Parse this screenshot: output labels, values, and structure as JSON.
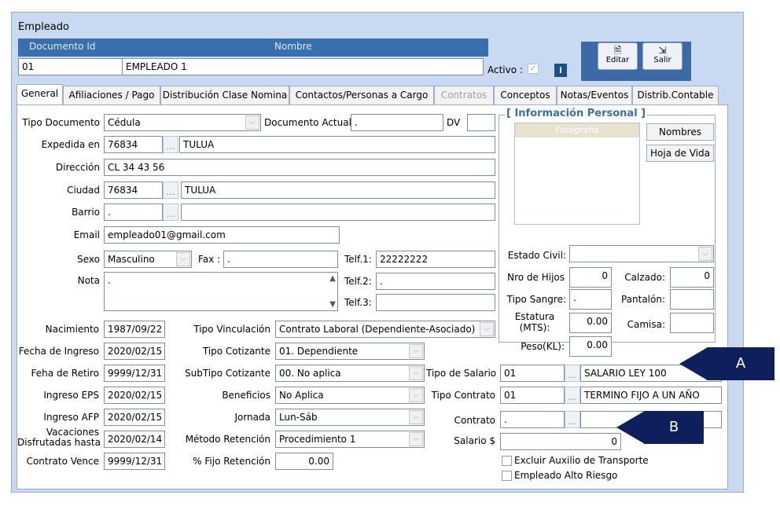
{
  "window": {
    "title": "Empleado"
  },
  "header": {
    "doc_id_label": "Documento Id",
    "nombre_label": "Nombre",
    "doc_id_value": "01",
    "nombre_value": "EMPLEADO 1",
    "activo_label": "Activo :",
    "info_icon": "i",
    "editar_label": "Editar",
    "salir_label": "Salir"
  },
  "tabs": [
    {
      "label": "General"
    },
    {
      "label": "Afiliaciones / Pago"
    },
    {
      "label": "Distribución Clase Nomina"
    },
    {
      "label": "Contactos/Personas a Cargo"
    },
    {
      "label": "Contratos"
    },
    {
      "label": "Conceptos"
    },
    {
      "label": "Notas/Eventos"
    },
    {
      "label": "Distrib.Contable"
    }
  ],
  "form": {
    "tipo_documento": {
      "label": "Tipo Documento",
      "value": "Cédula"
    },
    "documento_actual": {
      "label": "Documento Actual",
      "value": "."
    },
    "dv": {
      "label": "DV",
      "value": ""
    },
    "expedida_en": {
      "label": "Expedida en",
      "code": "76834",
      "name": "TULUA"
    },
    "direccion": {
      "label": "Dirección",
      "value": "CL 34 43 56"
    },
    "ciudad": {
      "label": "Ciudad",
      "code": "76834",
      "name": "TULUA"
    },
    "barrio": {
      "label": "Barrio",
      "code": ".",
      "name": ""
    },
    "email": {
      "label": "Email",
      "value": "empleado01@gmail.com"
    },
    "sexo": {
      "label": "Sexo",
      "value": "Masculino"
    },
    "fax": {
      "label": "Fax :",
      "value": "."
    },
    "telf1": {
      "label": "Telf.1:",
      "value": "22222222"
    },
    "telf2": {
      "label": "Telf.2:",
      "value": "."
    },
    "telf3": {
      "label": "Telf.3:",
      "value": ""
    },
    "nota": {
      "label": "Nota",
      "value": "."
    },
    "nacimiento": {
      "label": "Nacimiento",
      "value": "1987/09/22"
    },
    "fecha_ingreso": {
      "label": "Fecha de Ingreso",
      "value": "2020/02/15"
    },
    "fecha_retiro": {
      "label": "Feha de Retiro",
      "value": "9999/12/31"
    },
    "ingreso_eps": {
      "label": "Ingreso EPS",
      "value": "2020/02/15"
    },
    "ingreso_afp": {
      "label": "Ingreso AFP",
      "value": "2020/02/15"
    },
    "vacaciones": {
      "label1": "Vacaciones",
      "label2": "Disfrutadas hasta",
      "value": "2020/02/14"
    },
    "contrato_vence": {
      "label": "Contrato Vence",
      "value": "9999/12/31"
    },
    "tipo_vinculacion": {
      "label": "Tipo Vinculación",
      "value": "Contrato Laboral (Dependiente-Asociado)"
    },
    "tipo_cotizante": {
      "label": "Tipo Cotizante",
      "value": "01. Dependiente"
    },
    "subtipo_cotizante": {
      "label": "SubTipo Cotizante",
      "value": "00. No aplica"
    },
    "beneficios": {
      "label": "Beneficios",
      "value": "No Aplica"
    },
    "jornada": {
      "label": "Jornada",
      "value": "Lun-Sáb"
    },
    "metodo_retencion": {
      "label": "Método Retención",
      "value": "Procedimiento 1"
    },
    "fijo_retencion": {
      "label": "% Fijo Retención",
      "value": "0.00"
    },
    "tipo_salario": {
      "label": "Tipo de Salario",
      "code": "01",
      "name": "SALARIO LEY 100"
    },
    "tipo_contrato": {
      "label": "Tipo Contrato",
      "code": "01",
      "name": "TERMINO FIJO A UN AÑO"
    },
    "contrato": {
      "label": "Contrato",
      "code": ".",
      "name": ""
    },
    "salario": {
      "label": "Salario $",
      "value": "0"
    },
    "excluir_auxilio": {
      "label": "Excluir Auxilio de Transporte"
    },
    "alto_riesgo": {
      "label": "Empleado Alto Riesgo"
    }
  },
  "personal": {
    "group_title": "[ Información Personal ]",
    "foto_label": "Fotografia",
    "nombres_btn": "Nombres",
    "hoja_vida_btn": "Hoja de Vida",
    "estado_civil": {
      "label": "Estado Civil:",
      "value": ""
    },
    "nro_hijos": {
      "label": "Nro de Hijos",
      "value": "0"
    },
    "calzado": {
      "label": "Calzado:",
      "value": "0"
    },
    "tipo_sangre": {
      "label": "Tipo Sangre:",
      "value": "."
    },
    "pantalon": {
      "label": "Pantalón:",
      "value": ""
    },
    "estatura": {
      "label1": "Estatura",
      "label2": "(MTS):",
      "value": "0.00"
    },
    "camisa": {
      "label": "Camisa:",
      "value": ""
    },
    "peso": {
      "label": "Peso(KL):",
      "value": "0.00"
    }
  },
  "callouts": {
    "a": "A",
    "b": "B"
  },
  "colors": {
    "header_blue": "#3a6fad",
    "window_bg": "#c9d9f1",
    "callout_navy": "#0e1f5c"
  }
}
